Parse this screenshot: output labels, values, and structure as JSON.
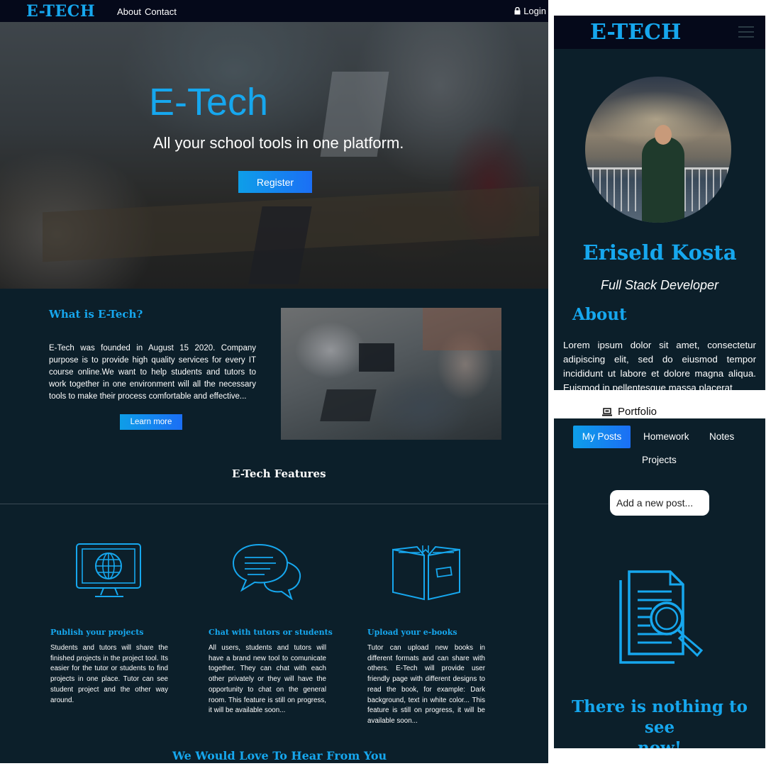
{
  "colors": {
    "accent": "#16a7ee",
    "background": "#0c1f2a",
    "navbar": "#05091a",
    "button_gradient": [
      "#0e9ee8",
      "#1b6ff5"
    ]
  },
  "desktop": {
    "nav": {
      "brand": "E-TECH",
      "about": "About",
      "contact": "Contact",
      "login": "Login",
      "login_icon": "lock-icon"
    },
    "hero": {
      "title": "E-Tech",
      "subtitle": "All your school tools in one platform.",
      "register_label": "Register"
    },
    "about": {
      "heading": "What is E-Tech?",
      "text": "E-Tech was founded in August 15 2020. Company purpose is to provide high quality services for every IT course online.We want to help students and tutors to work together in one environment will all the necessary tools to make their process comfortable and effective...",
      "learn_more_label": "Learn more"
    },
    "features_heading": "E-Tech Features",
    "features": [
      {
        "icon": "monitor-globe-icon",
        "title": "Publish your projects",
        "text": "Students and tutors will share the finished projects in the project tool. Its easier for the tutor or students to find projects in one place. Tutor can see student project and the other way around."
      },
      {
        "icon": "chat-bubbles-icon",
        "title": "Chat with tutors or students",
        "text": "All users, students and tutors will have a brand new tool to comunicate together. They can chat with each other privately or they will have the opportunity to chat on the general room. This feature is still on progress, it will be available soon..."
      },
      {
        "icon": "open-book-icon",
        "title": "Upload your e-books",
        "text": "Tutor can upload new books in different formats and can share with others. E-Tech will provide user friendly page with different designs to read the book, for example: Dark background, text in white color... This feature is still on progress, it will be available soon..."
      }
    ],
    "contact_heading": "We Would Love To Hear From You"
  },
  "mobile_profile": {
    "brand": "E-TECH",
    "menu_icon": "hamburger-menu-icon",
    "name": "Eriseld Kosta",
    "role": "Full Stack Developer",
    "about_heading": "About",
    "about_text": "Lorem ipsum dolor sit amet, consectetur adipiscing elit, sed do eiusmod tempor incididunt ut labore et dolore magna aliqua. Euismod in pellentesque massa placerat"
  },
  "mobile_portfolio": {
    "title": "Portfolio",
    "title_icon": "laptop-icon",
    "tabs": [
      "My Posts",
      "Homework",
      "Notes",
      "Projects"
    ],
    "active_tab": "My Posts",
    "add_post_label": "Add a new post...",
    "empty_icon": "document-search-icon",
    "empty_line1": "There is nothing to see",
    "empty_line2": "now!"
  }
}
